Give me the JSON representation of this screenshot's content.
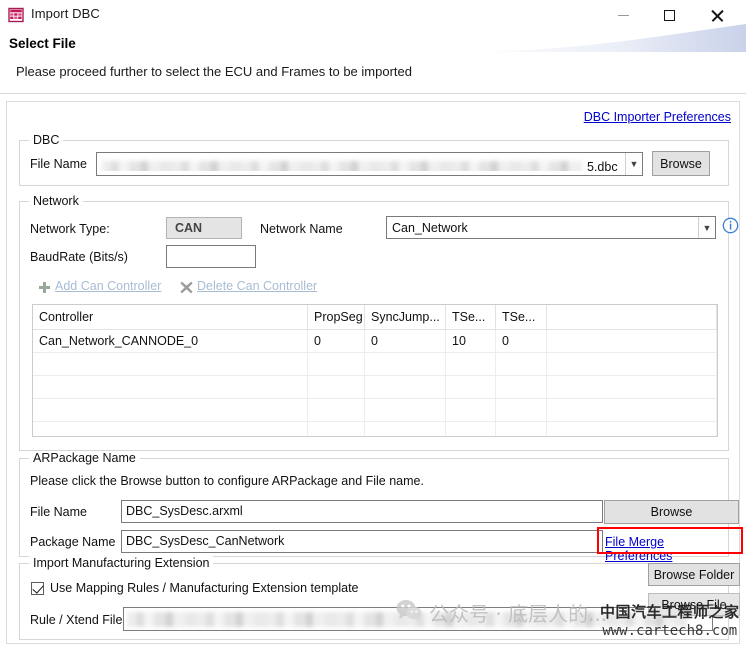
{
  "window": {
    "title": "Import DBC",
    "icon": "import-dbc-icon",
    "minimize_label": "Minimize",
    "maximize_label": "Maximize",
    "close_label": "Close"
  },
  "wizard": {
    "title": "Select File",
    "subtitle": "Please proceed further to select the ECU and Frames to be imported"
  },
  "prefs_link": "DBC Importer Preferences",
  "dbc_group": {
    "legend": "DBC",
    "file_name_label": "File Name",
    "file_name_value": "5.dbc",
    "file_name_redacted": true,
    "browse_label": "Browse"
  },
  "network_group": {
    "legend": "Network",
    "type_label": "Network Type:",
    "type_value": "CAN",
    "name_label": "Network Name",
    "name_value": "Can_Network",
    "info_icon": "info-icon",
    "baudrate_label": "BaudRate (Bits/s)",
    "baudrate_value": "",
    "add_controller_label": "Add Can Controller",
    "add_icon": "plus-icon",
    "delete_controller_label": "Delete Can Controller",
    "delete_icon": "x-icon"
  },
  "controller_table": {
    "columns": [
      "Controller",
      "PropSeg",
      "SyncJump...",
      "TSe...",
      "TSe...",
      ""
    ],
    "rows": [
      [
        "Can_Network_CANNODE_0",
        "0",
        "0",
        "10",
        "0",
        ""
      ]
    ],
    "empty_rows": 4
  },
  "arpackage_group": {
    "legend": "ARPackage Name",
    "hint": "Please click the Browse button to configure ARPackage and File name.",
    "file_name_label": "File Name",
    "file_name_value": "DBC_SysDesc.arxml",
    "browse_label": "Browse",
    "package_name_label": "Package Name",
    "package_name_value": "DBC_SysDesc_CanNetwork",
    "file_merge_link": "File Merge Preferences",
    "highlight_color": "#ff0000"
  },
  "manufacturing_group": {
    "legend": "Import Manufacturing Extension",
    "checkbox_label": "Use Mapping Rules / Manufacturing Extension template",
    "checkbox_checked": true,
    "rule_file_label": "Rule / Xtend File :",
    "rule_file_value": "",
    "rule_file_redacted": true,
    "browse_folder_label": "Browse Folder",
    "browse_file_label": "Browse File"
  },
  "watermarks": {
    "left_text": "公众号 · 底层人的...",
    "left_icon": "wechat-icon",
    "right_line1": "中国汽车工程师之家",
    "right_line2": "www.cartech8.com"
  },
  "colors": {
    "link": "#0000cc",
    "highlight": "#ff0000",
    "disabled_link": "#a8bcd4",
    "accent": "#c2185b"
  }
}
